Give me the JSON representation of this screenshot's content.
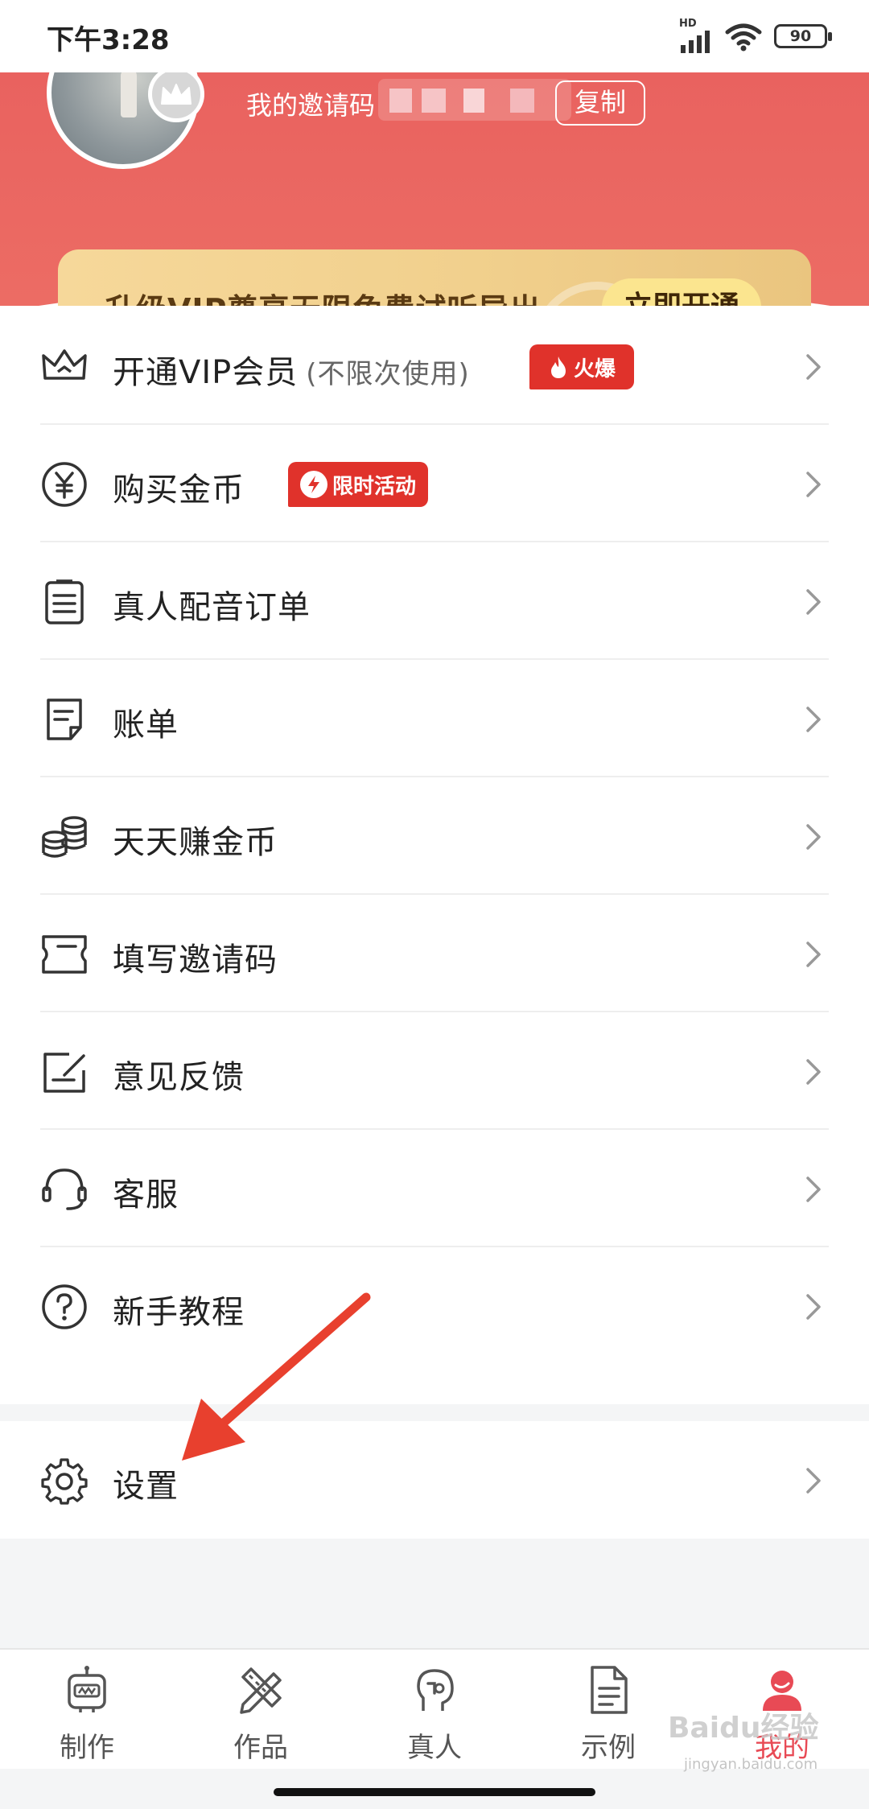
{
  "status_bar": {
    "time": "下午3:28",
    "network": "HD",
    "battery": "90"
  },
  "profile": {
    "invite_label": "我的邀请码",
    "copy_label": "复制"
  },
  "vip_banner": {
    "text": "升级VIP尊享无限免费试听导出",
    "button": "立即开通"
  },
  "menu": {
    "items": [
      {
        "label": "开通VIP会员",
        "sub": "(不限次使用)",
        "badge": "火爆",
        "icon": "crown-icon"
      },
      {
        "label": "购买金币",
        "badge": "限时活动",
        "icon": "yuan-coin-icon"
      },
      {
        "label": "真人配音订单",
        "icon": "order-list-icon"
      },
      {
        "label": "账单",
        "icon": "bill-icon"
      },
      {
        "label": "天天赚金币",
        "icon": "coin-stack-icon"
      },
      {
        "label": "填写邀请码",
        "icon": "ticket-icon"
      },
      {
        "label": "意见反馈",
        "icon": "feedback-icon"
      },
      {
        "label": "客服",
        "icon": "headset-icon"
      },
      {
        "label": "新手教程",
        "icon": "help-icon"
      }
    ],
    "settings": {
      "label": "设置",
      "icon": "gear-icon"
    }
  },
  "bottom_nav": {
    "items": [
      {
        "label": "制作",
        "icon": "robot-icon"
      },
      {
        "label": "作品",
        "icon": "pencil-ruler-icon"
      },
      {
        "label": "真人",
        "icon": "voice-head-icon"
      },
      {
        "label": "示例",
        "icon": "document-icon"
      },
      {
        "label": "我的",
        "icon": "profile-icon",
        "active": true
      }
    ]
  },
  "watermark": {
    "brand": "Baidu经验",
    "url": "jingyan.baidu.com"
  },
  "colors": {
    "header_red": "#e9625f",
    "vip_gold": "#f3d393",
    "badge_red": "#e0322b",
    "active_tab": "#e84a55",
    "annotation_arrow": "#e8402e"
  }
}
